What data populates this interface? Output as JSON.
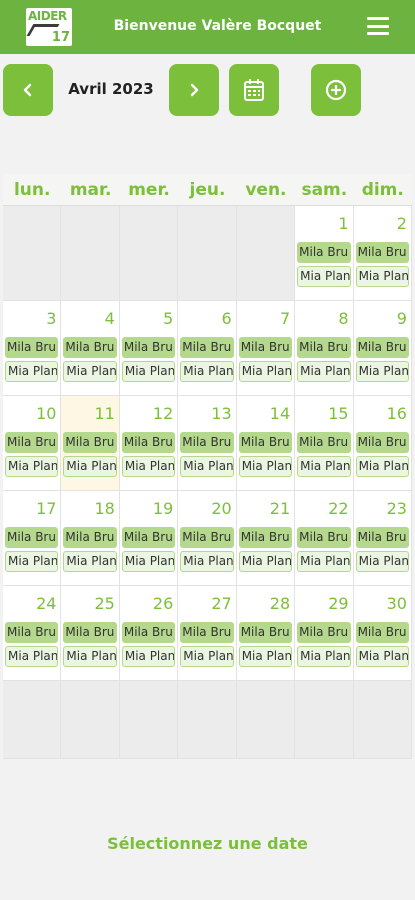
{
  "header": {
    "logo_top": "AIDER",
    "logo_bottom": "17",
    "welcome": "Bienvenue Valère Bocquet"
  },
  "toolbar": {
    "month": "Avril 2023"
  },
  "calendar": {
    "weekdays": [
      "lun.",
      "mar.",
      "mer.",
      "jeu.",
      "ven.",
      "sam.",
      "dim."
    ],
    "weeks": [
      [
        null,
        null,
        null,
        null,
        null,
        "1",
        "2"
      ],
      [
        "3",
        "4",
        "5",
        "6",
        "7",
        "8",
        "9"
      ],
      [
        "10",
        "11",
        "12",
        "13",
        "14",
        "15",
        "16"
      ],
      [
        "17",
        "18",
        "19",
        "20",
        "21",
        "22",
        "23"
      ],
      [
        "24",
        "25",
        "26",
        "27",
        "28",
        "29",
        "30"
      ],
      [
        null,
        null,
        null,
        null,
        null,
        null,
        null
      ]
    ],
    "today": "11",
    "event_primary": "Mila Bru",
    "event_secondary": "Mia Plan"
  },
  "footer": {
    "message": "Sélectionnez une date"
  },
  "colors": {
    "brand_green": "#6db33f",
    "accent_green": "#7cbf3a",
    "event_green": "#b5d98c",
    "today_bg": "#fdf7e3"
  }
}
